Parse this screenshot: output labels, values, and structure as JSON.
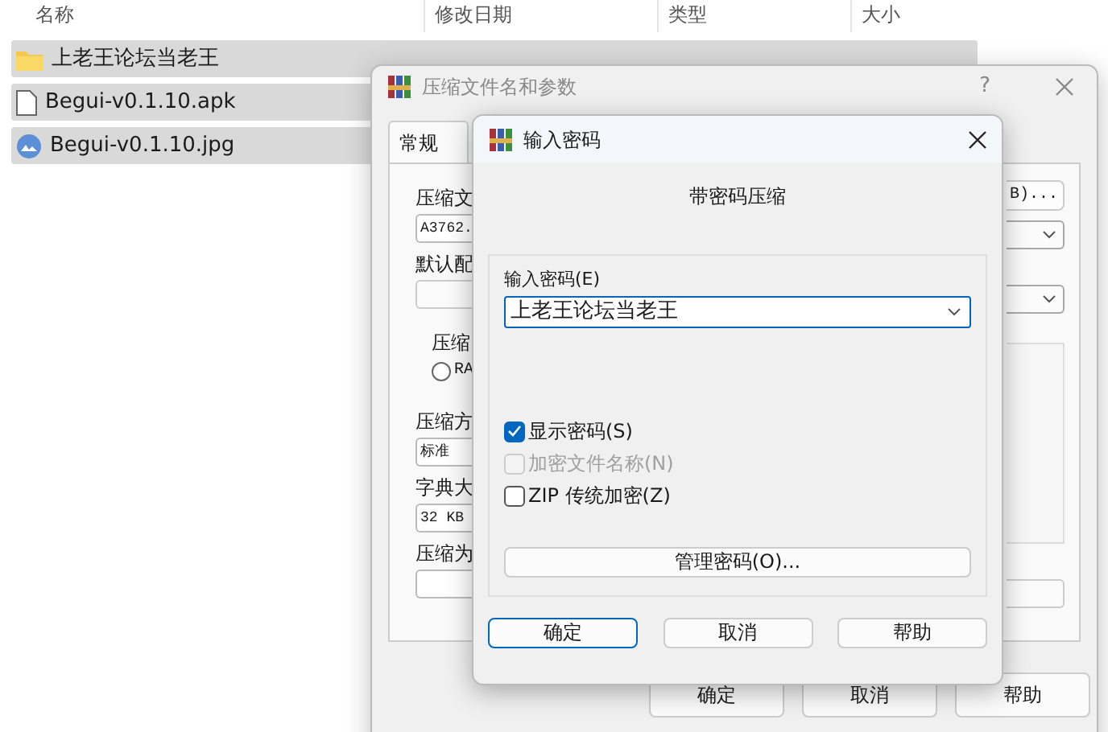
{
  "explorer": {
    "columns": [
      "名称",
      "修改日期",
      "类型",
      "大小"
    ],
    "rows": [
      {
        "name": "上老王论坛当老王",
        "kind": "folder",
        "selected": true
      },
      {
        "name": "Begui-v0.1.10.apk",
        "kind": "file",
        "selected": true
      },
      {
        "name": "Begui-v0.1.10.jpg",
        "kind": "image",
        "selected": true
      }
    ]
  },
  "archive_dialog": {
    "title": "压缩文件名和参数",
    "help": "?",
    "tabs": [
      {
        "label": "常规",
        "selected": true
      }
    ],
    "left_items": [
      {
        "kind": "label",
        "text": "压缩文"
      },
      {
        "kind": "field",
        "text": "A3762."
      },
      {
        "kind": "label",
        "text": "默认配"
      },
      {
        "kind": "dropdown"
      },
      {
        "kind": "group",
        "text": "压缩"
      },
      {
        "kind": "radio",
        "text": "RA",
        "selected": false
      },
      {
        "kind": "label",
        "text": "压缩方"
      },
      {
        "kind": "field",
        "text": "标准"
      },
      {
        "kind": "label",
        "text": "字典大"
      },
      {
        "kind": "field",
        "text": "32 KB"
      },
      {
        "kind": "label",
        "text": "压缩为"
      },
      {
        "kind": "field"
      }
    ],
    "right_items": [
      {
        "kind": "button",
        "text": "B)..."
      },
      {
        "kind": "dropdown"
      },
      {
        "kind": "dropdown"
      },
      {
        "kind": "panel"
      },
      {
        "kind": "field"
      }
    ],
    "buttons": [
      "确定",
      "取消",
      "帮助"
    ]
  },
  "password_dialog": {
    "title": "输入密码",
    "heading": "带密码压缩",
    "password_label": "输入密码(E)",
    "password_value": "上老王论坛当老王",
    "options": [
      {
        "label": "显示密码(S)",
        "checked": true,
        "disabled": false
      },
      {
        "label": "加密文件名称(N)",
        "checked": false,
        "disabled": true
      },
      {
        "label": "ZIP 传统加密(Z)",
        "checked": false,
        "disabled": false
      }
    ],
    "manage_button": "管理密码(O)...",
    "buttons": [
      {
        "label": "确定",
        "default": true
      },
      {
        "label": "取消",
        "default": false
      },
      {
        "label": "帮助",
        "default": false
      }
    ]
  }
}
